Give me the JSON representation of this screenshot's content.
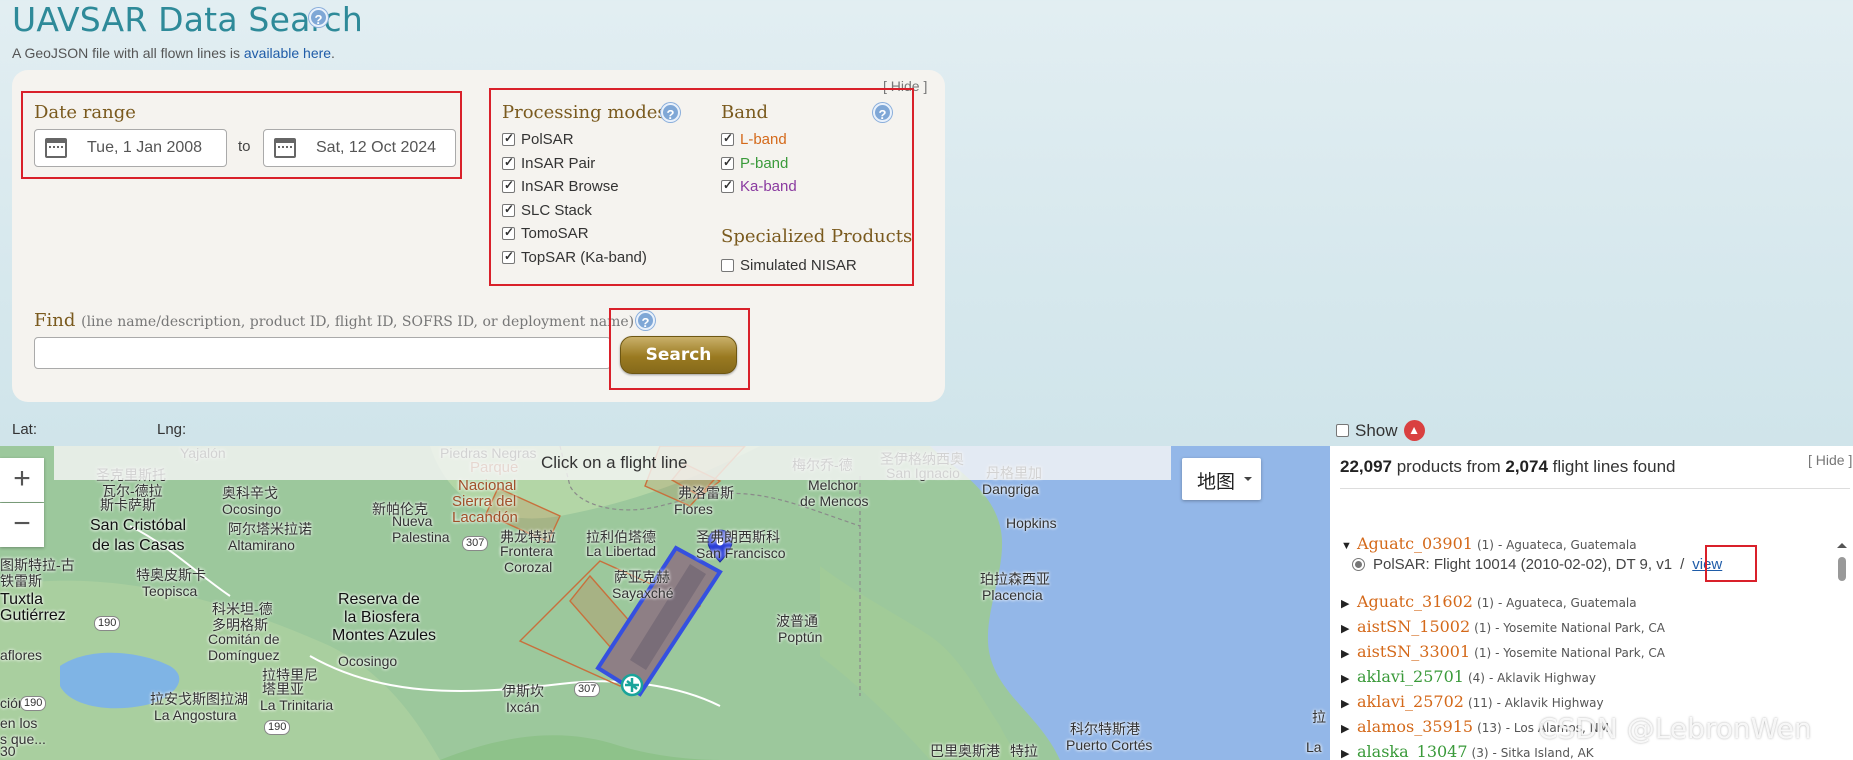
{
  "header": {
    "title": "UAVSAR Data Search",
    "geojson_prefix": "A GeoJSON file with all flown lines is ",
    "geojson_link": "available here",
    "geojson_suffix": "."
  },
  "panel": {
    "hide_label": "[ Hide ]",
    "date_range": {
      "label": "Date range",
      "from": "Tue, 1 Jan 2008",
      "to_label": "to",
      "to": "Sat, 12 Oct 2024"
    },
    "processing_modes": {
      "label": "Processing modes",
      "items": [
        {
          "label": "PolSAR",
          "checked": true
        },
        {
          "label": "InSAR Pair",
          "checked": true
        },
        {
          "label": "InSAR Browse",
          "checked": true
        },
        {
          "label": "SLC Stack",
          "checked": true
        },
        {
          "label": "TomoSAR",
          "checked": true
        },
        {
          "label": "TopSAR (Ka-band)",
          "checked": true
        }
      ]
    },
    "band": {
      "label": "Band",
      "items": [
        {
          "label": "L-band",
          "checked": true,
          "color": "#d4691a"
        },
        {
          "label": "P-band",
          "checked": true,
          "color": "#3a9a3a"
        },
        {
          "label": "Ka-band",
          "checked": true,
          "color": "#8a3aa0"
        }
      ]
    },
    "specialized": {
      "label": "Specialized Products",
      "items": [
        {
          "label": "Simulated NISAR",
          "checked": false
        }
      ]
    },
    "find": {
      "label": "Find",
      "hint": "(line name/description, product ID, flight ID, SOFRS ID, or deployment name)",
      "value": "",
      "search_label": "Search"
    }
  },
  "coords": {
    "lat_label": "Lat:",
    "lng_label": "Lng:",
    "show_label": "Show",
    "warn_icon": "▲"
  },
  "map": {
    "banner": "Click on a flight line",
    "zoom_in": "+",
    "zoom_out": "−",
    "map_type": "地图",
    "labels": [
      {
        "text": "Yajalón",
        "cls": ""
      },
      {
        "text": "Piedras Negras",
        "cls": ""
      },
      {
        "text": "Parque",
        "cls": "park"
      },
      {
        "text": "Nacional",
        "cls": "park"
      },
      {
        "text": "Sierra del",
        "cls": "park"
      },
      {
        "text": "Lacandón",
        "cls": "park"
      },
      {
        "text": "圣克里斯托",
        "cls": ""
      },
      {
        "text": "瓦尔-德拉",
        "cls": ""
      },
      {
        "text": "斯卡萨斯",
        "cls": ""
      },
      {
        "text": "San Cristóbal",
        "cls": "big"
      },
      {
        "text": "de las Casas",
        "cls": "big"
      },
      {
        "text": "奥科辛戈",
        "cls": ""
      },
      {
        "text": "Ocosingo",
        "cls": ""
      },
      {
        "text": "阿尔塔米拉诺",
        "cls": ""
      },
      {
        "text": "Altamirano",
        "cls": ""
      },
      {
        "text": "新帕伦克",
        "cls": ""
      },
      {
        "text": "Nueva",
        "cls": ""
      },
      {
        "text": "Palestina",
        "cls": ""
      },
      {
        "text": "弗龙特拉",
        "cls": ""
      },
      {
        "text": "Frontera",
        "cls": ""
      },
      {
        "text": "Corozal",
        "cls": ""
      },
      {
        "text": "拉利伯塔德",
        "cls": ""
      },
      {
        "text": "La Libertad",
        "cls": ""
      },
      {
        "text": "弗洛雷斯",
        "cls": ""
      },
      {
        "text": "Flores",
        "cls": ""
      },
      {
        "text": "圣弗朗西斯科",
        "cls": ""
      },
      {
        "text": "San Francisco",
        "cls": ""
      },
      {
        "text": "萨亚克赫",
        "cls": ""
      },
      {
        "text": "Sayaxché",
        "cls": ""
      },
      {
        "text": "梅尔乔-德",
        "cls": ""
      },
      {
        "text": "Melchor",
        "cls": ""
      },
      {
        "text": "de Mencos",
        "cls": ""
      },
      {
        "text": "圣伊格纳西奥",
        "cls": ""
      },
      {
        "text": "San Ignacio",
        "cls": ""
      },
      {
        "text": "丹格里加",
        "cls": ""
      },
      {
        "text": "Dangriga",
        "cls": ""
      },
      {
        "text": "Hopkins",
        "cls": ""
      },
      {
        "text": "图斯特拉-古",
        "cls": ""
      },
      {
        "text": "铁雷斯",
        "cls": ""
      },
      {
        "text": "Tuxtla",
        "cls": "big"
      },
      {
        "text": "Gutiérrez",
        "cls": "big"
      },
      {
        "text": "特奥皮斯卡",
        "cls": ""
      },
      {
        "text": "Teopisca",
        "cls": ""
      },
      {
        "text": "科米坦-德",
        "cls": ""
      },
      {
        "text": "多明格斯",
        "cls": ""
      },
      {
        "text": "Comitán de",
        "cls": ""
      },
      {
        "text": "Domínguez",
        "cls": ""
      },
      {
        "text": "Reserva de",
        "cls": "big"
      },
      {
        "text": "la Biosfera",
        "cls": "big"
      },
      {
        "text": "Montes Azules",
        "cls": "big"
      },
      {
        "text": "波普通",
        "cls": ""
      },
      {
        "text": "Poptún",
        "cls": ""
      },
      {
        "text": "珀拉森西亚",
        "cls": ""
      },
      {
        "text": "Placencia",
        "cls": ""
      },
      {
        "text": "Ocosingo",
        "cls": ""
      },
      {
        "text": "拉特里尼",
        "cls": ""
      },
      {
        "text": "塔里亚",
        "cls": ""
      },
      {
        "text": "La Trinitaria",
        "cls": ""
      },
      {
        "text": "拉安戈斯图拉湖",
        "cls": ""
      },
      {
        "text": "La Angostura",
        "cls": ""
      },
      {
        "text": "伊斯坎",
        "cls": ""
      },
      {
        "text": "Ixcán",
        "cls": ""
      },
      {
        "text": "科尔特斯港",
        "cls": ""
      },
      {
        "text": "Puerto Cortés",
        "cls": ""
      },
      {
        "text": "巴里奥斯港",
        "cls": ""
      },
      {
        "text": "特拉",
        "cls": ""
      },
      {
        "text": "拉",
        "cls": ""
      },
      {
        "text": "La",
        "cls": ""
      },
      {
        "text": "ción",
        "cls": ""
      },
      {
        "text": "en los",
        "cls": ""
      },
      {
        "text": "s que...",
        "cls": ""
      },
      {
        "text": "aflores",
        "cls": ""
      },
      {
        "text": "30",
        "cls": ""
      }
    ],
    "route_badges": [
      "307",
      "190",
      "307",
      "190",
      "190"
    ]
  },
  "results": {
    "count_products": "22,097",
    "count_mid": " products from ",
    "count_lines": "2,074",
    "count_suffix": " flight lines found",
    "hide_label": "[ Hide ]",
    "lines": [
      {
        "name": "Aguatc_03901",
        "count": "(1)",
        "desc": "- Aguateca, Guatemala",
        "color": "#d4691a",
        "expanded": true
      },
      {
        "name": "Aguatc_31602",
        "count": "(1)",
        "desc": "- Aguateca, Guatemala",
        "color": "#d4691a",
        "expanded": false
      },
      {
        "name": "aistSN_15002",
        "count": "(1)",
        "desc": "- Yosemite National Park, CA",
        "color": "#d4691a",
        "expanded": false
      },
      {
        "name": "aistSN_33001",
        "count": "(1)",
        "desc": "- Yosemite National Park, CA",
        "color": "#d4691a",
        "expanded": false
      },
      {
        "name": "aklavi_25701",
        "count": "(4)",
        "desc": "- Aklavik Highway",
        "color": "#3a9a3a",
        "expanded": false
      },
      {
        "name": "aklavi_25702",
        "count": "(11)",
        "desc": "- Aklavik Highway",
        "color": "#d4691a",
        "expanded": false
      },
      {
        "name": "alamos_35915",
        "count": "(13)",
        "desc": "- Los Alamos, NM",
        "color": "#d4691a",
        "expanded": false
      },
      {
        "name": "alaska_13047",
        "count": "(3)",
        "desc": "- Sitka Island, AK",
        "color": "#3a9a3a",
        "expanded": false
      }
    ],
    "product": {
      "text": "PolSAR: Flight 10014 (2010-02-02), DT 9, v1",
      "sep": "/",
      "view_label": "view"
    }
  },
  "watermark": "CSDN @LebronWen"
}
